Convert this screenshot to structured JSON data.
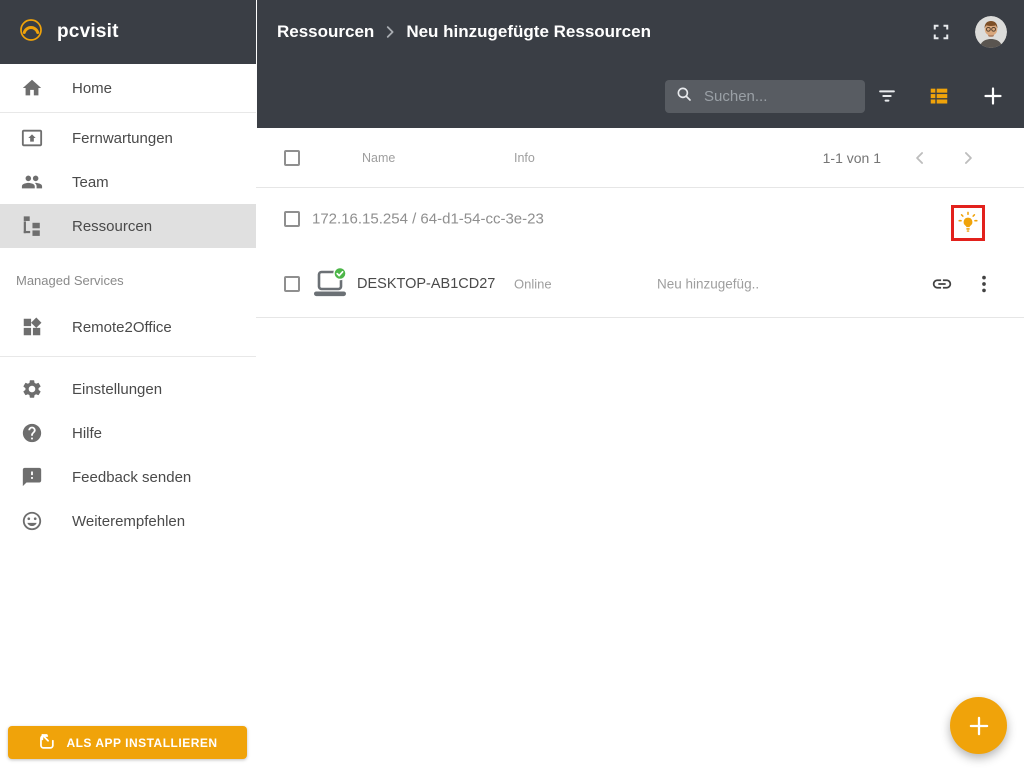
{
  "brand": {
    "name": "pcvisit"
  },
  "colors": {
    "accent": "#F0A30A",
    "header_bg": "#3A3E45",
    "selected_item_bg": "#E0E0E0",
    "highlight_red": "#E2211C",
    "online_green": "#4CB648"
  },
  "sidebar": {
    "items": [
      {
        "label": "Home"
      },
      {
        "label": "Fernwartungen"
      },
      {
        "label": "Team"
      },
      {
        "label": "Ressourcen",
        "selected": true
      }
    ],
    "section_label": "Managed Services",
    "managed_items": [
      {
        "label": "Remote2Office"
      }
    ],
    "footer_items": [
      {
        "label": "Einstellungen"
      },
      {
        "label": "Hilfe"
      },
      {
        "label": "Feedback senden"
      },
      {
        "label": "Weiterempfehlen"
      }
    ],
    "install_button_label": "ALS APP INSTALLIEREN"
  },
  "header": {
    "breadcrumb": {
      "parent": "Ressourcen",
      "current": "Neu hinzugefügte Ressourcen"
    },
    "search_placeholder": "Suchen..."
  },
  "table": {
    "columns": {
      "name": "Name",
      "info": "Info"
    },
    "pagination": "1-1 von 1",
    "rows": [
      {
        "name": "172.16.15.254 / 64-d1-54-cc-3e-23"
      },
      {
        "name": "DESKTOP-AB1CD27",
        "status": "Online",
        "info": "Neu hinzugefüg.."
      }
    ]
  }
}
